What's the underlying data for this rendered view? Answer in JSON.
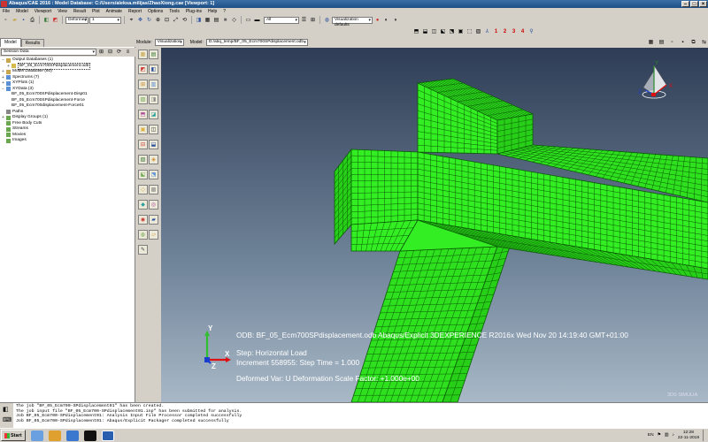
{
  "window": {
    "title": "Abaqus/CAE 2016 : Model Database: C:/Users/aleksa.milijas/ZhaoXiong.cae [Viewport: 1]",
    "controls": [
      "–",
      "□",
      "×"
    ]
  },
  "menu": [
    "File",
    "Model",
    "Viewport",
    "View",
    "Result",
    "Plot",
    "Animate",
    "Report",
    "Options",
    "Tools",
    "Plug-ins",
    "Help",
    "?"
  ],
  "toolbar": {
    "plot_state": "Deformed",
    "step_value": "1",
    "all_value": "All",
    "vis_defaults": "Visualization defaults",
    "view_numbers": [
      "1",
      "2",
      "3",
      "4"
    ]
  },
  "module_bar": {
    "module_label": "Module:",
    "module_value": "Visualization",
    "model_label": "Model:",
    "model_value": "D:/abq_temp/BF_05_Ecm700SPdisplacement.odb"
  },
  "left_panel": {
    "tabs": [
      "Model",
      "Results"
    ],
    "session_label": "Session Data",
    "tree": [
      {
        "label": "Output Databases (1)",
        "indent": 0,
        "exp": "−",
        "icon": "#c9a64b"
      },
      {
        "label": "BF_05_Ecm700SPdisplacement.odb",
        "indent": 1,
        "exp": "+",
        "icon": "#d8b94b",
        "highlight": true
      },
      {
        "label": "Model Database (60)",
        "indent": 0,
        "exp": "+",
        "icon": "#c9a64b"
      },
      {
        "label": "Spectrums (7)",
        "indent": 0,
        "exp": "+",
        "icon": "#5a8fd6"
      },
      {
        "label": "XYPlots (1)",
        "indent": 0,
        "exp": "+",
        "icon": "#5a8fd6"
      },
      {
        "label": "XYData (3)",
        "indent": 0,
        "exp": "−",
        "icon": "#5a8fd6"
      },
      {
        "label": "BF_05_Ecm700SPdisplacement-Disp01",
        "indent": 1,
        "exp": "",
        "icon": ""
      },
      {
        "label": "BF_05_Ecm700SPdisplacement-Force",
        "indent": 1,
        "exp": "",
        "icon": ""
      },
      {
        "label": "BF_05_Ecm700displacement-Force01",
        "indent": 1,
        "exp": "",
        "icon": ""
      },
      {
        "label": "Paths",
        "indent": 0,
        "exp": "",
        "icon": "#888888"
      },
      {
        "label": "Display Groups (1)",
        "indent": 0,
        "exp": "+",
        "icon": "#6aa84f"
      },
      {
        "label": "Free Body Cuts",
        "indent": 0,
        "exp": "",
        "icon": "#6aa84f"
      },
      {
        "label": "Streams",
        "indent": 0,
        "exp": "",
        "icon": "#6aa84f"
      },
      {
        "label": "Movies",
        "indent": 0,
        "exp": "",
        "icon": "#6aa84f"
      },
      {
        "label": "Images",
        "indent": 0,
        "exp": "",
        "icon": "#6aa84f"
      }
    ]
  },
  "viewport": {
    "odb_line": "ODB: BF_05_Ecm700SPdisplacement.odb    Abaqus/Explicit 3DEXPERIENCE R2016x    Wed Nov 20 14:19:40 GMT+01:00",
    "step_line": "Step: Horizontal Load",
    "increment_line": "Increment    558955: Step Time =     1.000",
    "deformed_line": "Deformed Var: U   Deformation Scale Factor: +1.000e+00",
    "simulia": "3DS SIMULIA",
    "axis_x": "X",
    "axis_y": "Y",
    "axis_z": "Z",
    "compass_y": "Y",
    "compass_x": "X",
    "compass_z": "Z"
  },
  "messages": [
    "The job \"BF_05_Ecm700-SPdisplacement01\" has been created.",
    "The job input file \"BF_05_Ecm700-SPdisplacement01.inp\" has been submitted for analysis.",
    "Job BF_05_Ecm700-SPdisplacement01: Analysis Input File Processor completed successfully",
    "Job BF_05_Ecm700-SPdisplacement01: Abaqus/Explicit Packager completed successfully"
  ],
  "taskbar": {
    "start": "Start",
    "lang": "EN",
    "time": "12:28",
    "date": "22-11-2019"
  },
  "colors": {
    "mesh_fill": "#33ee22",
    "mesh_line": "#0a5a05"
  }
}
